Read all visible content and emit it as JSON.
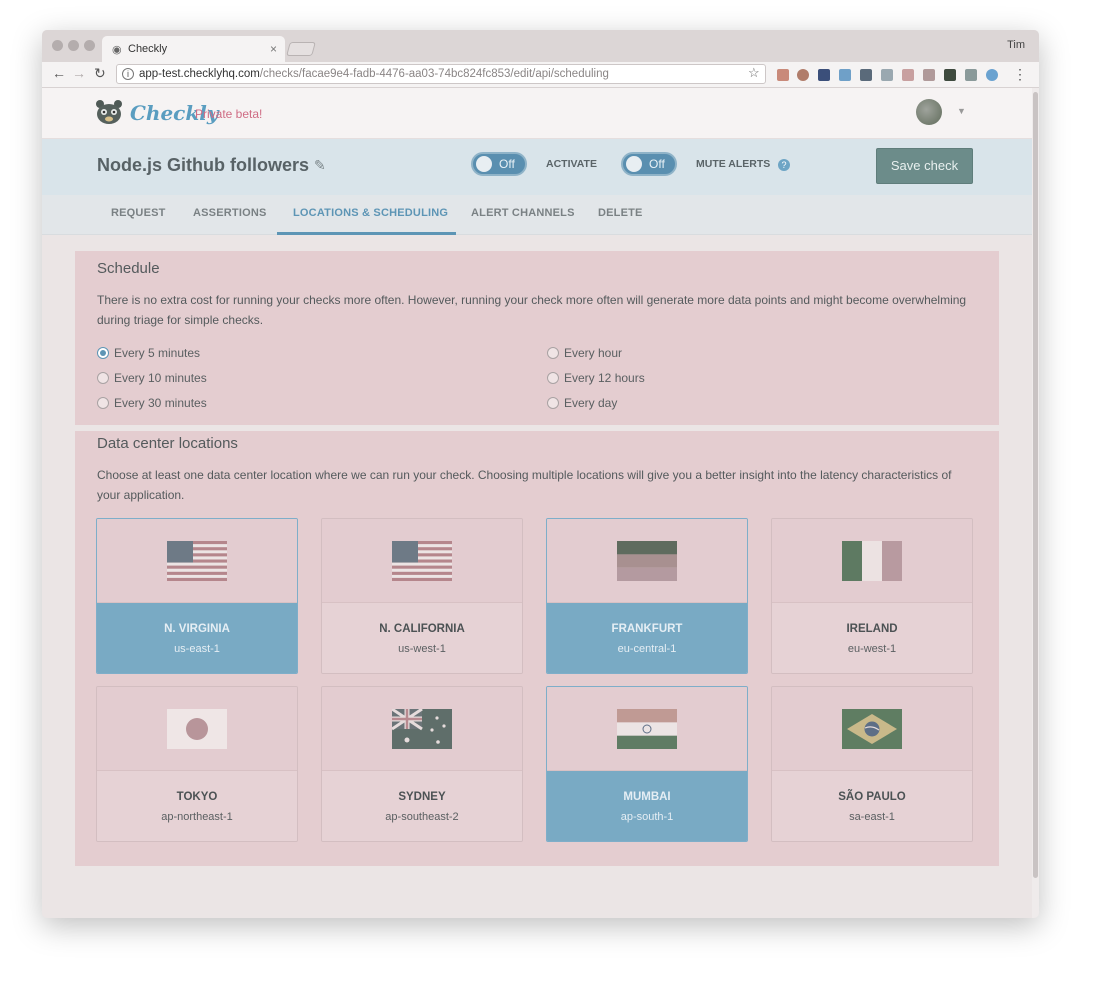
{
  "browser": {
    "tab_title": "Checkly",
    "user_name": "Tim",
    "url_host": "app-test.checklyhq.com",
    "url_path": "/checks/facae9e4-fadb-4476-aa03-74bc824fc853/edit/api/scheduling"
  },
  "app": {
    "logo_text": "Checkly",
    "beta_label": "Private beta!"
  },
  "check": {
    "title": "Node.js Github followers",
    "activate_toggle": "Off",
    "activate_label": "ACTIVATE",
    "mute_toggle": "Off",
    "mute_label": "MUTE ALERTS",
    "help_glyph": "?",
    "save_label": "Save check"
  },
  "tabs": [
    {
      "label": "REQUEST",
      "active": false
    },
    {
      "label": "ASSERTIONS",
      "active": false
    },
    {
      "label": "LOCATIONS & SCHEDULING",
      "active": true
    },
    {
      "label": "ALERT CHANNELS",
      "active": false
    },
    {
      "label": "DELETE",
      "active": false
    }
  ],
  "schedule": {
    "title": "Schedule",
    "description": "There is no extra cost for running your checks more often. However, running your check more often will generate more data points and might become overwhelming during triage for simple checks.",
    "options": [
      {
        "label": "Every 5 minutes",
        "selected": true
      },
      {
        "label": "Every 10 minutes",
        "selected": false
      },
      {
        "label": "Every 30 minutes",
        "selected": false
      },
      {
        "label": "Every hour",
        "selected": false
      },
      {
        "label": "Every 12 hours",
        "selected": false
      },
      {
        "label": "Every day",
        "selected": false
      }
    ]
  },
  "locations": {
    "title": "Data center locations",
    "description": "Choose at least one data center location where we can run your check. Choosing multiple locations will give you a better insight into the latency characteristics of your application.",
    "items": [
      {
        "name": "N. VIRGINIA",
        "region": "us-east-1",
        "selected": true,
        "flag": "us-flag-icon"
      },
      {
        "name": "N. CALIFORNIA",
        "region": "us-west-1",
        "selected": false,
        "flag": "us-flag-icon"
      },
      {
        "name": "FRANKFURT",
        "region": "eu-central-1",
        "selected": true,
        "flag": "germany-flag-icon"
      },
      {
        "name": "IRELAND",
        "region": "eu-west-1",
        "selected": false,
        "flag": "ireland-flag-icon"
      },
      {
        "name": "TOKYO",
        "region": "ap-northeast-1",
        "selected": false,
        "flag": "japan-flag-icon"
      },
      {
        "name": "SYDNEY",
        "region": "ap-southeast-2",
        "selected": false,
        "flag": "australia-flag-icon"
      },
      {
        "name": "MUMBAI",
        "region": "ap-south-1",
        "selected": true,
        "flag": "india-flag-icon"
      },
      {
        "name": "SÃO PAULO",
        "region": "sa-east-1",
        "selected": false,
        "flag": "brazil-flag-icon"
      }
    ]
  },
  "colors": {
    "accent": "#5d95b5",
    "selected_card": "#79aac4",
    "panel_bg": "#e4cdd0",
    "save_button": "#6c8c8a"
  }
}
